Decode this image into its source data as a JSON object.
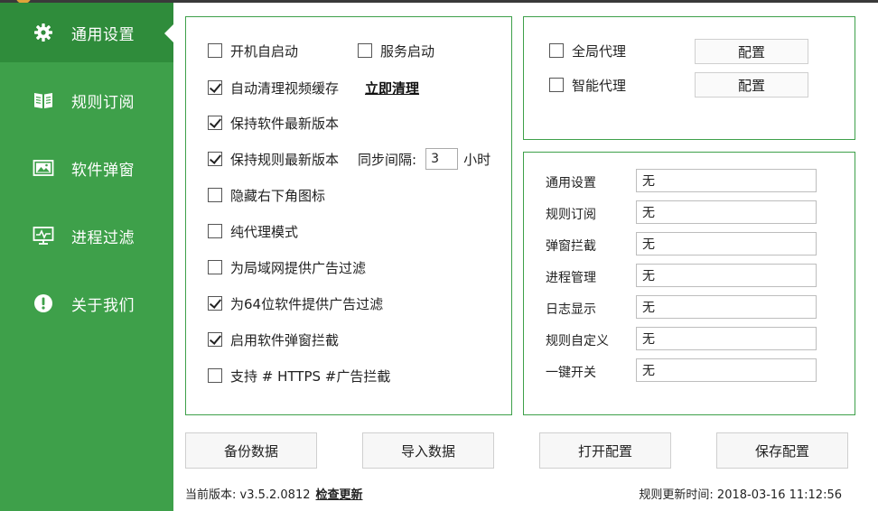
{
  "sidebar": {
    "items": [
      {
        "label": "通用设置",
        "icon": "gear-icon"
      },
      {
        "label": "规则订阅",
        "icon": "book-icon"
      },
      {
        "label": "软件弹窗",
        "icon": "image-window-icon"
      },
      {
        "label": "进程过滤",
        "icon": "monitor-icon"
      },
      {
        "label": "关于我们",
        "icon": "info-icon"
      }
    ],
    "active_index": 0,
    "bg_color": "#3ea04a",
    "active_color": "#2f8c3b"
  },
  "general": {
    "autostart": {
      "label": "开机自启动",
      "checked": false
    },
    "service_start": {
      "label": "服务启动",
      "checked": false
    },
    "auto_clean_cache": {
      "label": "自动清理视频缓存",
      "checked": true
    },
    "clean_now": "立即清理",
    "keep_latest_version": {
      "label": "保持软件最新版本",
      "checked": true
    },
    "keep_rules_latest": {
      "label": "保持规则最新版本",
      "checked": true
    },
    "sync_interval_label": "同步间隔:",
    "sync_interval_value": "3",
    "sync_interval_unit": "小时",
    "hide_tray_icon": {
      "label": "隐藏右下角图标",
      "checked": false
    },
    "pure_proxy": {
      "label": "纯代理模式",
      "checked": false
    },
    "lan_filter": {
      "label": "为局域网提供广告过滤",
      "checked": false
    },
    "x64_filter": {
      "label": "为64位软件提供广告过滤",
      "checked": true
    },
    "popup_block": {
      "label": "启用软件弹窗拦截",
      "checked": true
    },
    "https_filter": {
      "label": "支持 # HTTPS #广告拦截",
      "checked": false
    }
  },
  "proxy": {
    "global": {
      "label": "全局代理",
      "checked": false,
      "button": "配置"
    },
    "smart": {
      "label": "智能代理",
      "checked": false,
      "button": "配置"
    }
  },
  "hotkeys": [
    {
      "label": "通用设置",
      "value": "无"
    },
    {
      "label": "规则订阅",
      "value": "无"
    },
    {
      "label": "弹窗拦截",
      "value": "无"
    },
    {
      "label": "进程管理",
      "value": "无"
    },
    {
      "label": "日志显示",
      "value": "无"
    },
    {
      "label": "规则自定义",
      "value": "无"
    },
    {
      "label": "一键开关",
      "value": "无"
    }
  ],
  "buttons": {
    "backup": "备份数据",
    "import": "导入数据",
    "open_config": "打开配置",
    "save_config": "保存配置"
  },
  "footer": {
    "version_label": "当前版本: v3.5.2.0812",
    "check_update": "检查更新",
    "rule_update_time": "规则更新时间: 2018-03-16 11:12:56"
  }
}
